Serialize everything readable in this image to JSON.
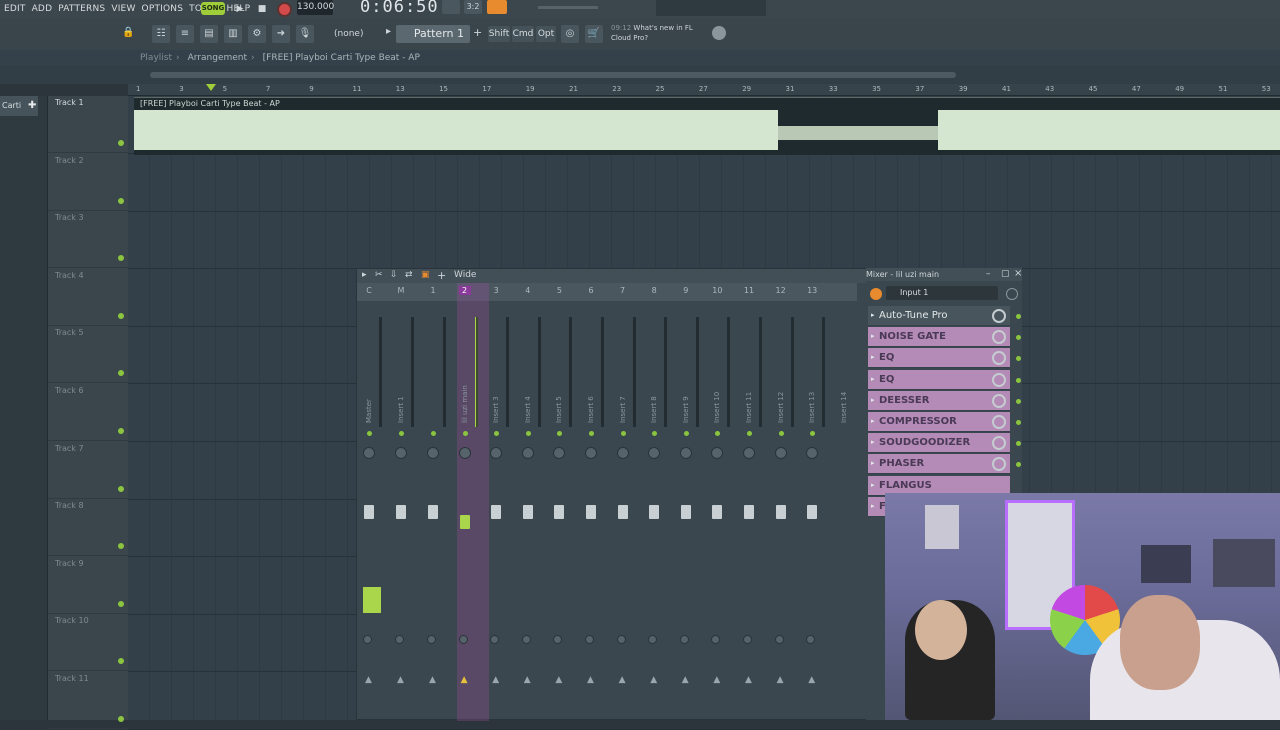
{
  "menu": {
    "items": [
      "EDIT",
      "ADD",
      "PATTERNS",
      "VIEW",
      "OPTIONS",
      "TOOLS",
      "HELP"
    ],
    "song": "SONG"
  },
  "transport": {
    "tempo": "130.000",
    "time": "0:06:50"
  },
  "toolbar": {
    "none": "(none)",
    "pattern": "Pattern 1",
    "shift": "Shift",
    "cmd": "Cmd",
    "opt": "Opt"
  },
  "news": {
    "time": "09:12",
    "title": "What's new in FL",
    "sub": "Cloud Pro?"
  },
  "breadcrumb": {
    "playlist": "Playlist",
    "arrangement": "Arrangement",
    "project": "[FREE] Playboi Carti Type Beat - AP"
  },
  "browser": {
    "tab": "Carti"
  },
  "ruler": [
    "1",
    "3",
    "5",
    "7",
    "9",
    "11",
    "13",
    "15",
    "17",
    "19",
    "21",
    "23",
    "25",
    "27",
    "29",
    "31",
    "33",
    "35",
    "37",
    "39",
    "41",
    "43",
    "45",
    "47",
    "49",
    "51",
    "53"
  ],
  "tracks": [
    "Track 1",
    "Track 2",
    "Track 3",
    "Track 4",
    "Track 5",
    "Track 6",
    "Track 7",
    "Track 8",
    "Track 9",
    "Track 10",
    "Track 11"
  ],
  "clip": {
    "label": "[FREE] Playboi Carti Type Beat - AP"
  },
  "mixer": {
    "preset": "Wide",
    "title": "Mixer - lil uzi main",
    "strip_numbers": [
      "C",
      "M",
      "1",
      "2",
      "3",
      "4",
      "5",
      "6",
      "7",
      "8",
      "9",
      "10",
      "11",
      "12",
      "13"
    ],
    "strip_names": [
      "Master",
      "Insert 1",
      "lil uzi main",
      "Insert 3",
      "Insert 4",
      "Insert 5",
      "Insert 6",
      "Insert 7",
      "Insert 8",
      "Insert 9",
      "Insert 10",
      "Insert 11",
      "Insert 12",
      "Insert 13",
      "Insert 14"
    ],
    "input": "Input 1",
    "fx": [
      "Auto-Tune Pro",
      "NOISE GATE",
      "EQ",
      "EQ",
      "DEESSER",
      "COMPRESSOR",
      "SOUDGOODIZER",
      "PHASER",
      "FLANGUS",
      "Fl"
    ]
  }
}
